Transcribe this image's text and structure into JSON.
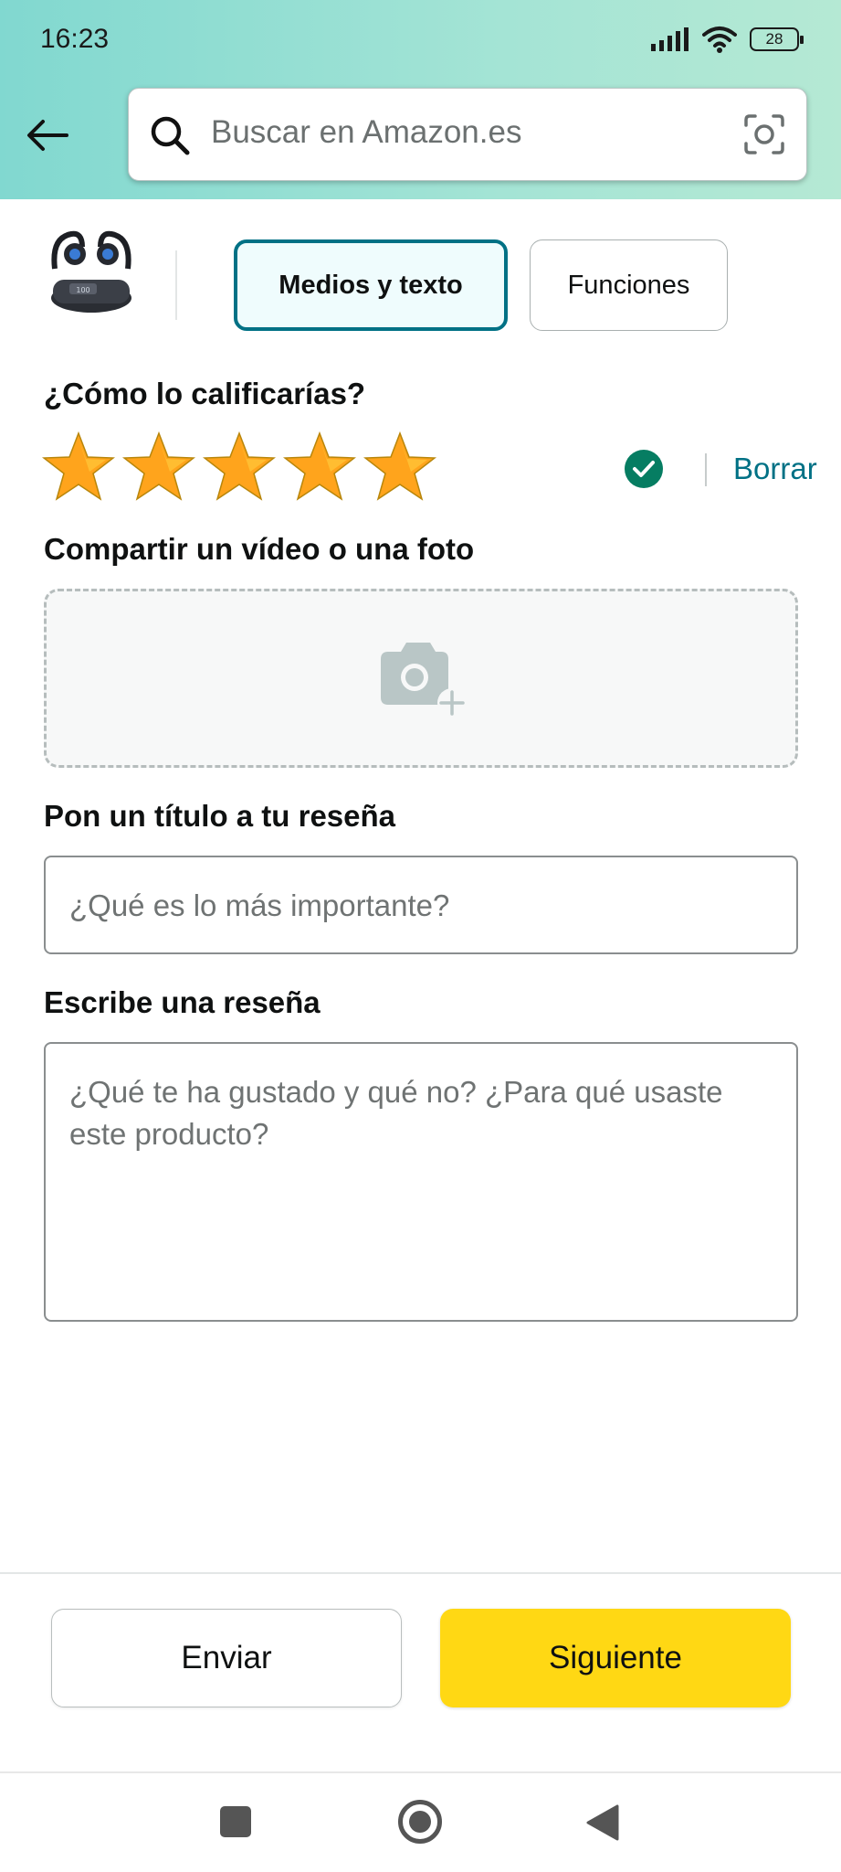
{
  "status_bar": {
    "time": "16:23",
    "battery": "28"
  },
  "search": {
    "placeholder": "Buscar en Amazon.es"
  },
  "tabs": [
    {
      "label": "Medios y texto",
      "selected": true
    },
    {
      "label": "Funciones",
      "selected": false
    }
  ],
  "rating": {
    "question": "¿Cómo lo calificarías?",
    "stars_selected": 5,
    "stars_total": 5,
    "clear_label": "Borrar"
  },
  "media": {
    "label": "Compartir un vídeo o una foto"
  },
  "title_field": {
    "label": "Pon un título a tu reseña",
    "placeholder": "¿Qué es lo más importante?"
  },
  "review_field": {
    "label": "Escribe una reseña",
    "placeholder": "¿Qué te ha gustado y qué no? ¿Para qué usaste este producto?"
  },
  "actions": {
    "send_label": "Enviar",
    "next_label": "Siguiente"
  },
  "colors": {
    "accent": "#007185",
    "primary_button": "#ffd814",
    "star": "#ffa41c",
    "check": "#067d62"
  }
}
